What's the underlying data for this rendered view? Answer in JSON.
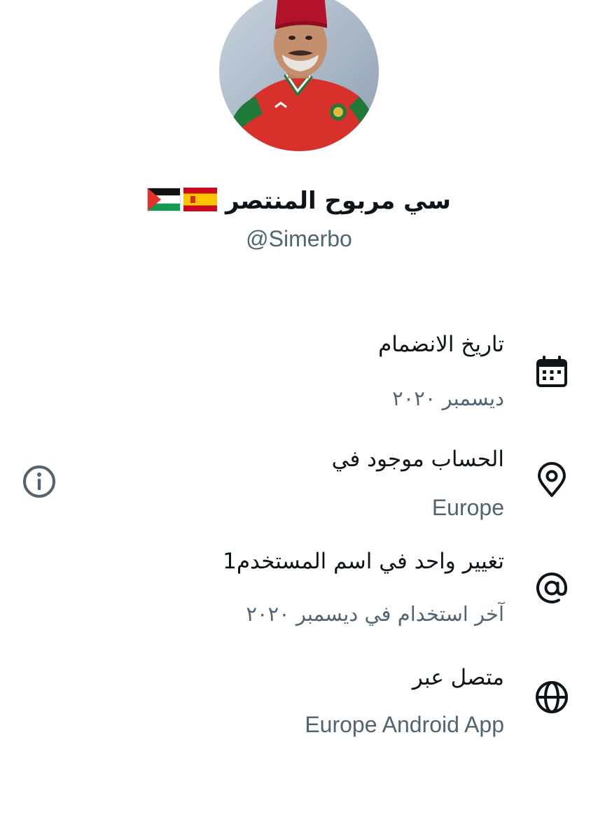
{
  "profile": {
    "display_name": "سي مربوح المنتصر",
    "flags": [
      "spain-flag",
      "palestine-flag"
    ],
    "handle": "@Simerbo"
  },
  "about": {
    "joined": {
      "title": "تاريخ الانضمام",
      "value": "ديسمبر ٢٠٢٠",
      "icon": "calendar-icon"
    },
    "location": {
      "title": "الحساب موجود في",
      "value": "Europe",
      "icon": "location-pin-icon",
      "info_icon": "info-icon"
    },
    "username_changes": {
      "title": "تغيير واحد في اسم المستخدم1",
      "value": "آخر استخدام في ديسمبر ٢٠٢٠",
      "icon": "at-sign-icon"
    },
    "connected_via": {
      "title": "متصل عبر",
      "value": "Europe Android App",
      "icon": "globe-icon"
    }
  },
  "colors": {
    "text_primary": "#0f1419",
    "text_secondary": "#536471",
    "background": "#ffffff"
  }
}
